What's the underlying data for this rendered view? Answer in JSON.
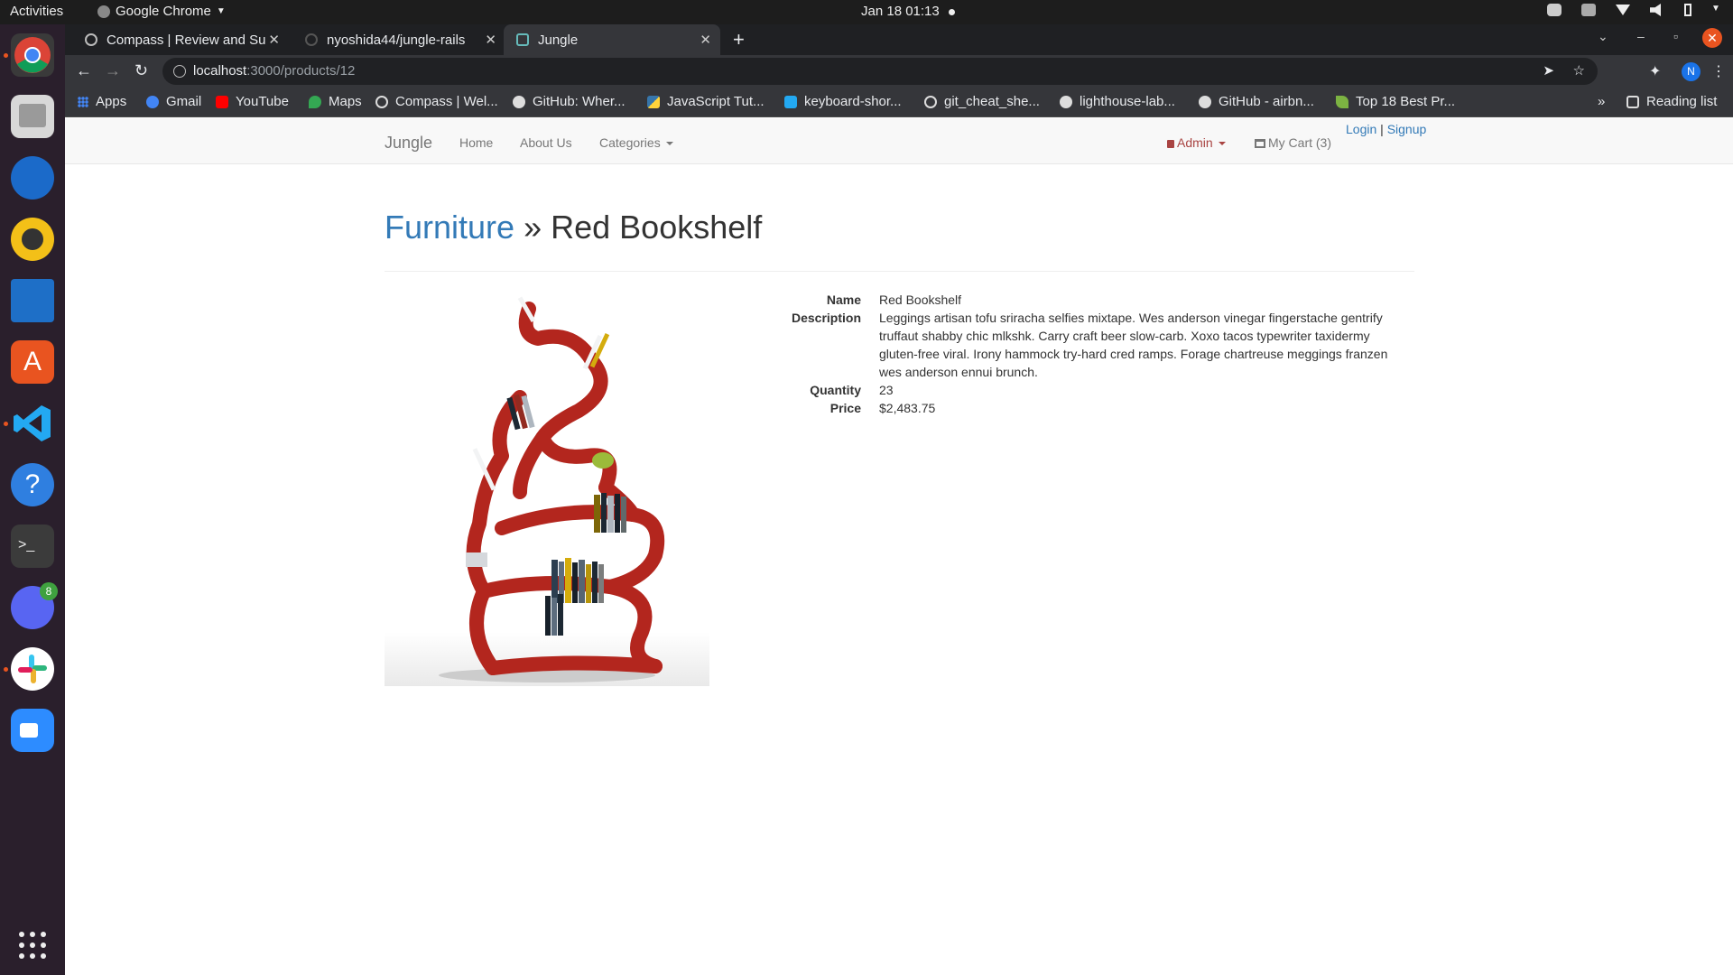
{
  "os": {
    "activities": "Activities",
    "app_name": "Google Chrome",
    "clock": "Jan 18  01:13",
    "dock_badge": "8"
  },
  "browser": {
    "tabs": [
      {
        "title": "Compass | Review and Sul"
      },
      {
        "title": "nyoshida44/jungle-rails"
      },
      {
        "title": "Jungle"
      }
    ],
    "url_host": "localhost",
    "url_path": ":3000/products/12",
    "profile_initial": "N",
    "bookmarks": [
      {
        "label": "Apps"
      },
      {
        "label": "Gmail"
      },
      {
        "label": "YouTube"
      },
      {
        "label": "Maps"
      },
      {
        "label": "Compass | Wel..."
      },
      {
        "label": "GitHub: Wher..."
      },
      {
        "label": "JavaScript Tut..."
      },
      {
        "label": "keyboard-shor..."
      },
      {
        "label": "git_cheat_she..."
      },
      {
        "label": "lighthouse-lab..."
      },
      {
        "label": "GitHub - airbn..."
      },
      {
        "label": "Top 18 Best Pr..."
      }
    ],
    "more_bookmarks": "»",
    "reading_list": "Reading list"
  },
  "site": {
    "brand": "Jungle",
    "nav": {
      "home": "Home",
      "about": "About Us",
      "categories": "Categories",
      "admin": "Admin",
      "cart": "My Cart (3)",
      "login": "Login",
      "separator": "|",
      "signup": "Signup"
    }
  },
  "product": {
    "category": "Furniture",
    "breadcrumb_sep": "»",
    "title": "Red Bookshelf",
    "fields": [
      {
        "label": "Name",
        "value": "Red Bookshelf"
      },
      {
        "label": "Description",
        "value": "Leggings artisan tofu sriracha selfies mixtape. Wes anderson vinegar fingerstache gentrify truffaut shabby chic mlkshk. Carry craft beer slow-carb. Xoxo tacos typewriter taxidermy gluten-free viral. Irony hammock try-hard cred ramps. Forage chartreuse meggings franzen wes anderson ennui brunch."
      },
      {
        "label": "Quantity",
        "value": "23"
      },
      {
        "label": "Price",
        "value": "$2,483.75"
      }
    ]
  },
  "colors": {
    "link": "#337ab7",
    "admin": "#a94442",
    "shelf": "#b3261e"
  }
}
